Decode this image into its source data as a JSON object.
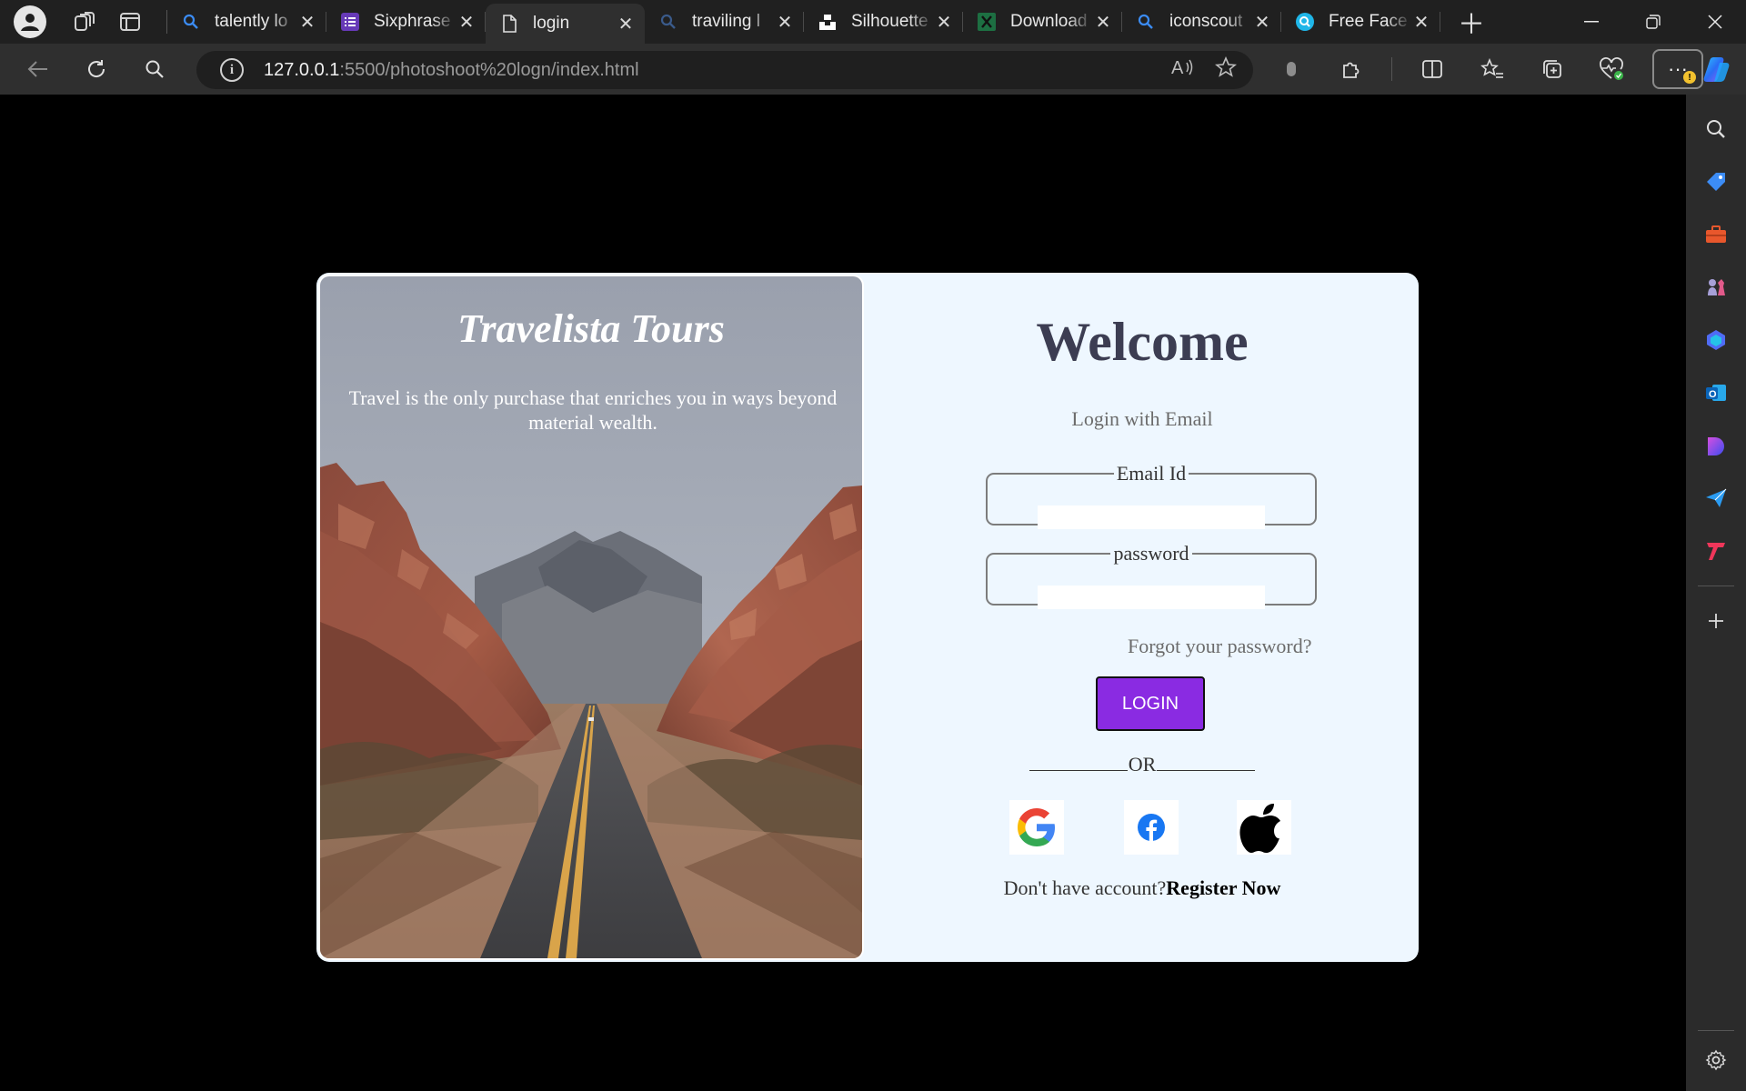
{
  "browser": {
    "tabs": [
      {
        "title": "talently lo",
        "icon": "search-icon",
        "active": false
      },
      {
        "title": "Sixphrase",
        "icon": "list-icon",
        "active": false
      },
      {
        "title": "login",
        "icon": "page-icon",
        "active": true
      },
      {
        "title": "traviling l",
        "icon": "search-icon",
        "active": false
      },
      {
        "title": "Silhouette",
        "icon": "unsplash-icon",
        "active": false
      },
      {
        "title": "Download",
        "icon": "excel-icon",
        "active": false
      },
      {
        "title": "iconscout",
        "icon": "search-icon",
        "active": false
      },
      {
        "title": "Free Face",
        "icon": "face-search-icon",
        "active": false
      }
    ],
    "url_host": "127.0.0.1",
    "url_rest": ":5500/photoshoot%20logn/index.html",
    "colors": {
      "tab_strip": "#202020",
      "toolbar": "#2f2f2f",
      "sidebar": "#2b2b2b"
    }
  },
  "page": {
    "brand": "Travelista Tours",
    "quote": "Travel is the only purchase that enriches you in ways beyond material wealth.",
    "welcome": "Welcome",
    "subtitle": "Login with Email",
    "email_legend": "Email Id",
    "password_legend": "password",
    "forgot": "Forgot your password?",
    "login_label": "LOGIN",
    "or_text": "OR",
    "register_prompt": "Don't have account?",
    "register_link": "Register Now",
    "social": [
      "google-icon",
      "facebook-icon",
      "apple-icon"
    ],
    "colors": {
      "card_bg": "#eef7ff",
      "login_button": "#8a2be2",
      "heading": "#3c3d52"
    }
  }
}
